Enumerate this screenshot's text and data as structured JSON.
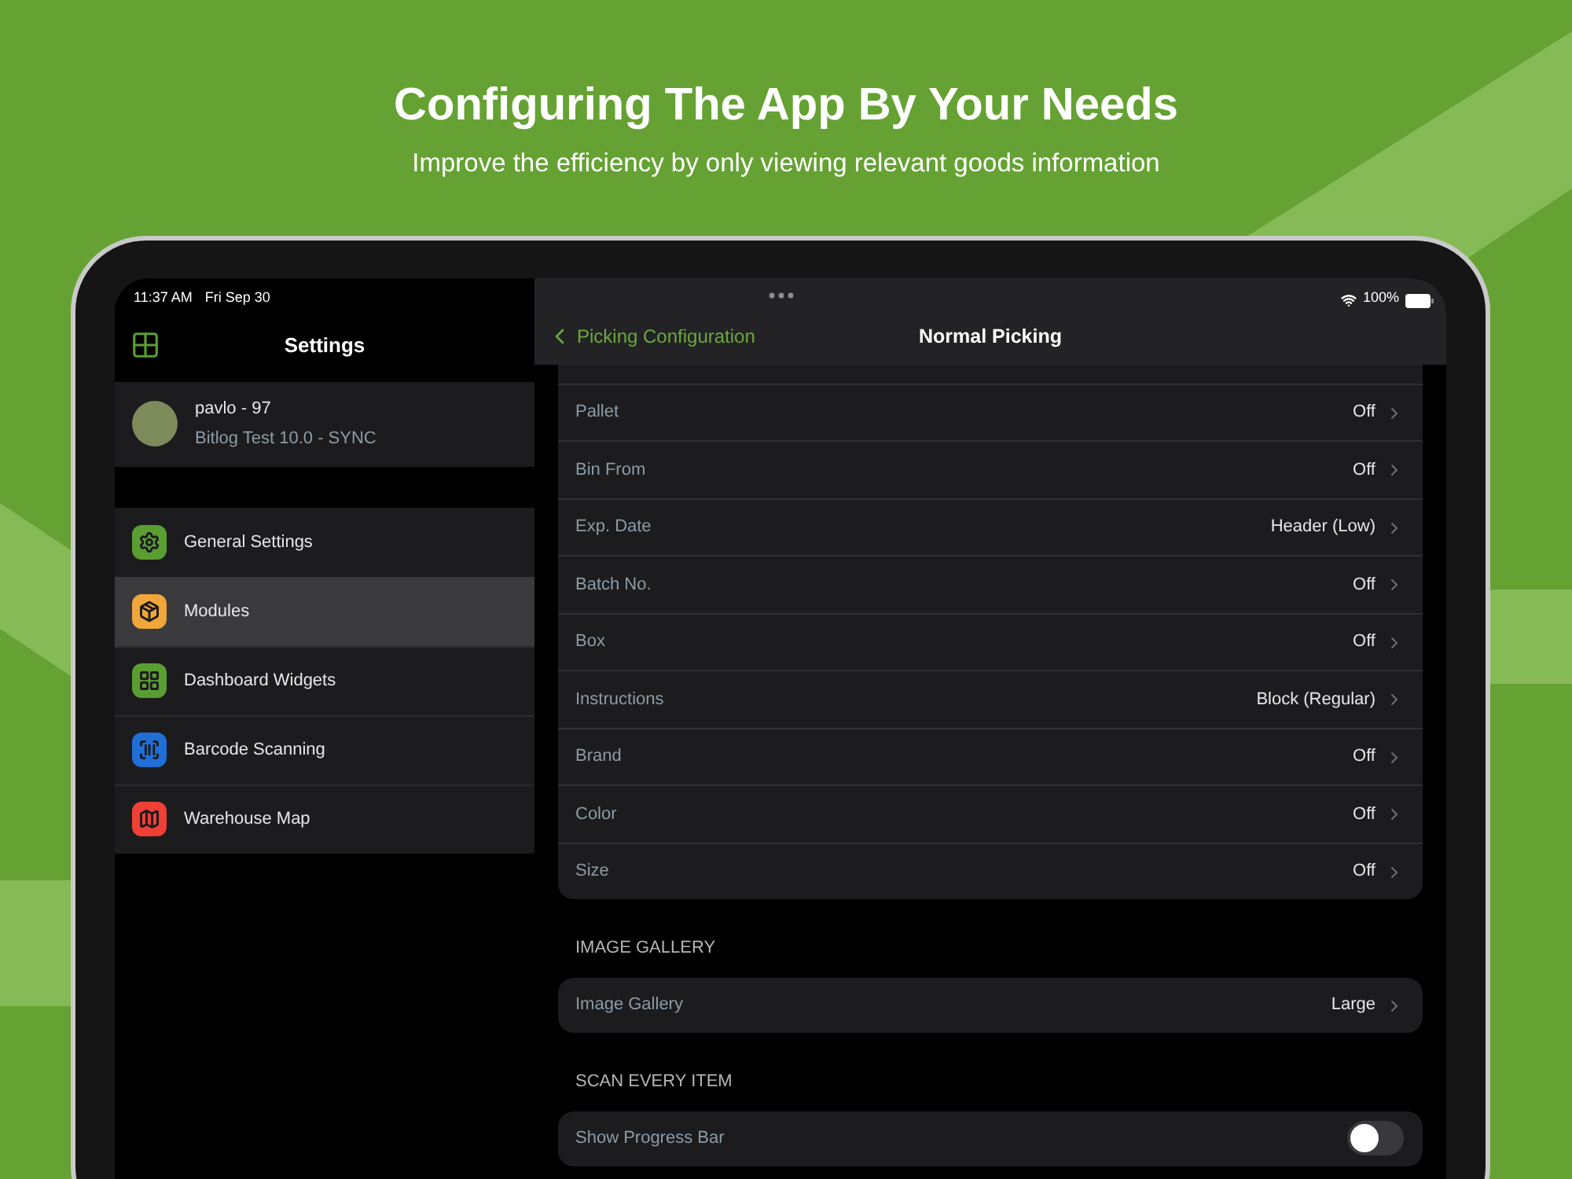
{
  "headline": {
    "title": "Configuring The App By Your Needs",
    "subtitle": "Improve the efficiency by only viewing relevant goods information"
  },
  "status_bar": {
    "time": "11:37 AM",
    "date": "Fri Sep 30",
    "battery": "100%"
  },
  "sidebar": {
    "title": "Settings",
    "profile": {
      "name": "pavlo - 97",
      "subtitle": "Bitlog Test 10.0 - SYNC"
    },
    "items": [
      {
        "label": "General Settings",
        "kind": "gear",
        "color": "#5a9e32",
        "selected": false
      },
      {
        "label": "Modules",
        "kind": "box",
        "color": "#f0a63a",
        "selected": true
      },
      {
        "label": "Dashboard Widgets",
        "kind": "grid",
        "color": "#5a9e32",
        "selected": false
      },
      {
        "label": "Barcode Scanning",
        "kind": "scan",
        "color": "#1f6fd6",
        "selected": false
      },
      {
        "label": "Warehouse Map",
        "kind": "map",
        "color": "#ef4036",
        "selected": false
      }
    ]
  },
  "nav": {
    "back": "Picking Configuration",
    "title": "Normal Picking"
  },
  "rows": [
    {
      "label": "Pallet",
      "value": "Off"
    },
    {
      "label": "Bin From",
      "value": "Off"
    },
    {
      "label": "Exp. Date",
      "value": "Header (Low)"
    },
    {
      "label": "Batch No.",
      "value": "Off"
    },
    {
      "label": "Box",
      "value": "Off"
    },
    {
      "label": "Instructions",
      "value": "Block (Regular)"
    },
    {
      "label": "Brand",
      "value": "Off"
    },
    {
      "label": "Color",
      "value": "Off"
    },
    {
      "label": "Size",
      "value": "Off"
    }
  ],
  "sections": [
    {
      "header": "IMAGE GALLERY",
      "rows": [
        {
          "kind": "value",
          "label": "Image Gallery",
          "value": "Large"
        }
      ]
    },
    {
      "header": "SCAN EVERY ITEM",
      "rows": [
        {
          "kind": "toggle",
          "label": "Show Progress Bar",
          "on": false
        }
      ]
    }
  ]
}
